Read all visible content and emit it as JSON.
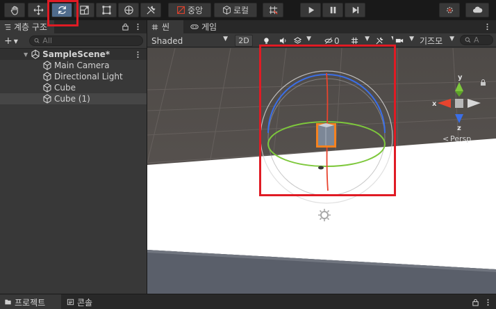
{
  "toolbar": {
    "pivot_label": "중앙",
    "local_label": "로컬"
  },
  "hierarchy": {
    "tab_label": "계층 구조",
    "search_placeholder": "All",
    "scene_name": "SampleScene*",
    "items": [
      {
        "label": "Main Camera"
      },
      {
        "label": "Directional Light"
      },
      {
        "label": "Cube"
      },
      {
        "label": "Cube (1)"
      }
    ]
  },
  "scene_view": {
    "scene_tab": "씬",
    "game_tab": "게임",
    "shading_mode": "Shaded",
    "mode_2d": "2D",
    "hidden_count": "0",
    "gizmos_label": "기즈모",
    "search_placeholder": "A",
    "persp_label": "Persp",
    "axis_x": "x",
    "axis_y": "y",
    "axis_z": "z"
  },
  "bottom": {
    "project_tab": "프로젝트",
    "console_tab": "콘솔"
  },
  "colors": {
    "highlight": "#e01b24",
    "active_tool": "#4f6b8c",
    "ground": "#ffffff",
    "sky": "#5a5552",
    "x_axis": "#e8442e",
    "y_axis": "#7ec83c",
    "z_axis": "#3a6ee8",
    "selection": "#f5821f"
  }
}
